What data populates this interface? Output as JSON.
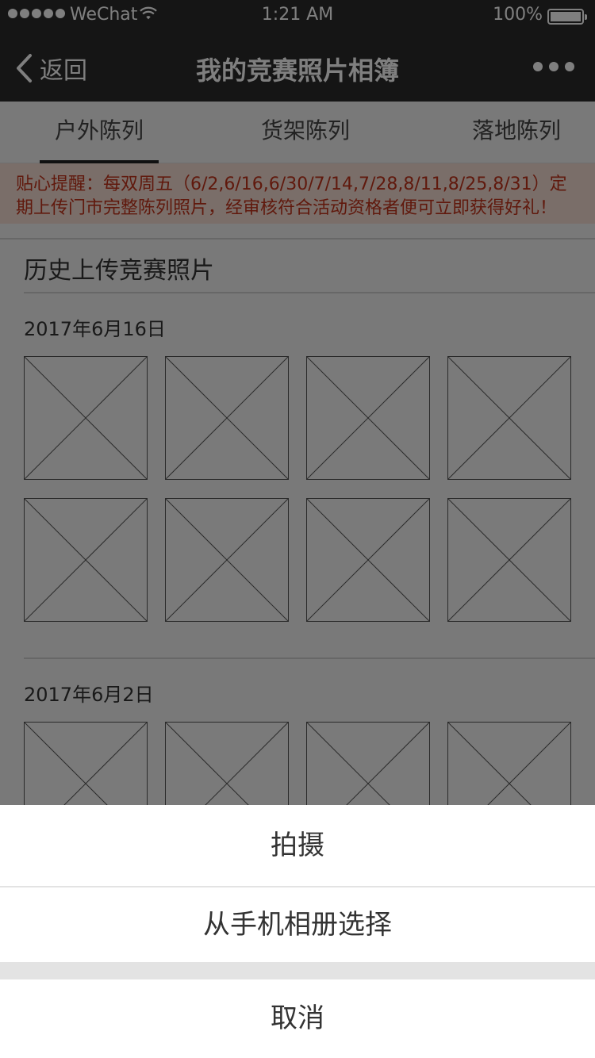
{
  "status_bar": {
    "carrier": "WeChat",
    "time": "1:21 AM",
    "battery": "100%"
  },
  "nav": {
    "back_label": "返回",
    "title": "我的竞赛照片相簿"
  },
  "tabs": [
    {
      "label": "户外陈列",
      "active": true
    },
    {
      "label": "货架陈列",
      "active": false
    },
    {
      "label": "落地陈列",
      "active": false
    }
  ],
  "notice": "贴心提醒：每双周五（6/2,6/16,6/30/7/14,7/28,8/11,8/25,8/31）定期上传门市完整陈列照片，经审核符合活动资格者便可立即获得好礼！",
  "history": {
    "title": "历史上传竞赛照片",
    "groups": [
      {
        "date": "2017年6月16日"
      },
      {
        "date": "2017年6月2日"
      }
    ]
  },
  "action_sheet": {
    "items": [
      {
        "label": "拍摄"
      },
      {
        "label": "从手机相册选择"
      }
    ],
    "cancel_label": "取消"
  },
  "colors": {
    "accent_text": "#c0321a",
    "nav_bg": "#2b2b2b"
  }
}
